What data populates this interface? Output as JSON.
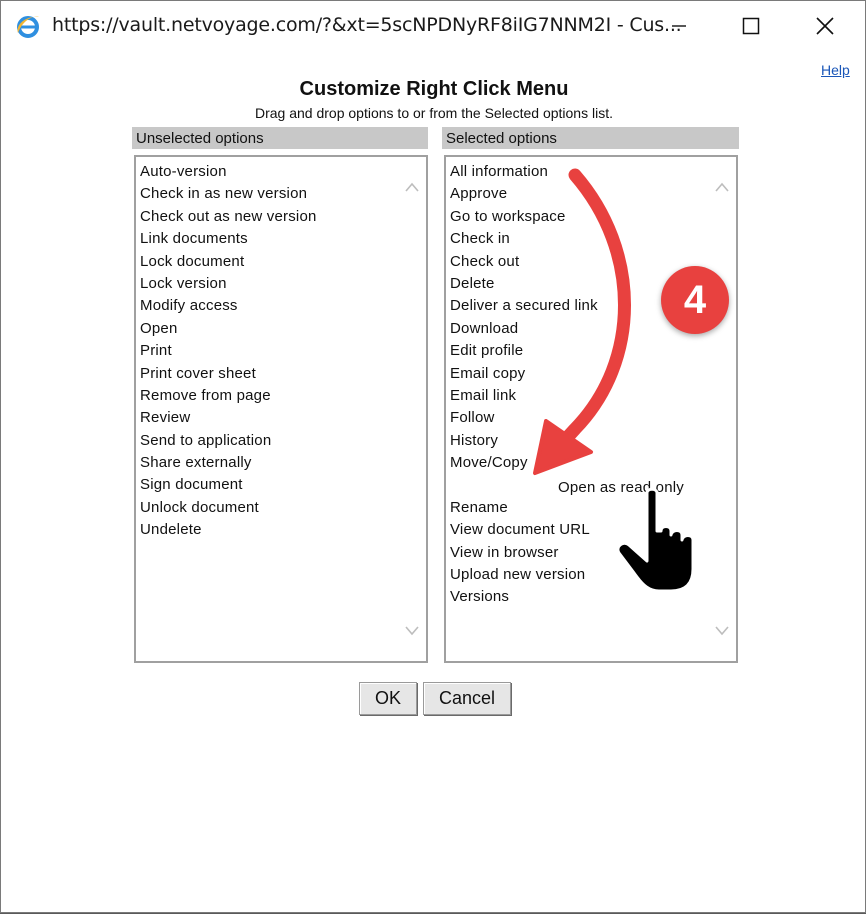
{
  "window": {
    "title": "https://vault.netvoyage.com/?&xt=5scNPDNyRF8iIG7NNM2I - Cus...",
    "icon": "internet-explorer-icon"
  },
  "dialog": {
    "help_label": "Help",
    "title": "Customize Right Click Menu",
    "subtitle": "Drag and drop options to or from the Selected options list.",
    "unselected_header": "Unselected options",
    "selected_header": "Selected options",
    "unselected_options": [
      "Auto-version",
      "Check in as new version",
      "Check out as new version",
      "Link documents",
      "Lock document",
      "Lock version",
      "Modify access",
      "Open",
      "Print",
      "Print cover sheet",
      "Remove from page",
      "Review",
      "Send to application",
      "Share externally",
      "Sign document",
      "Unlock document",
      "Undelete"
    ],
    "selected_options": [
      "All information",
      "Approve",
      "Go to workspace",
      "Check in",
      "Check out",
      "Delete",
      "Deliver a secured link",
      "Download",
      "Edit profile",
      "Email copy",
      "Email link",
      "Follow",
      "History",
      "Move/Copy",
      "",
      "Rename",
      "View document URL",
      "View in browser",
      "Upload new version",
      "Versions"
    ],
    "dragging_item": "Open as read only",
    "ok_label": "OK",
    "cancel_label": "Cancel"
  },
  "annotation": {
    "step_number": "4",
    "color": "#e8413f"
  }
}
